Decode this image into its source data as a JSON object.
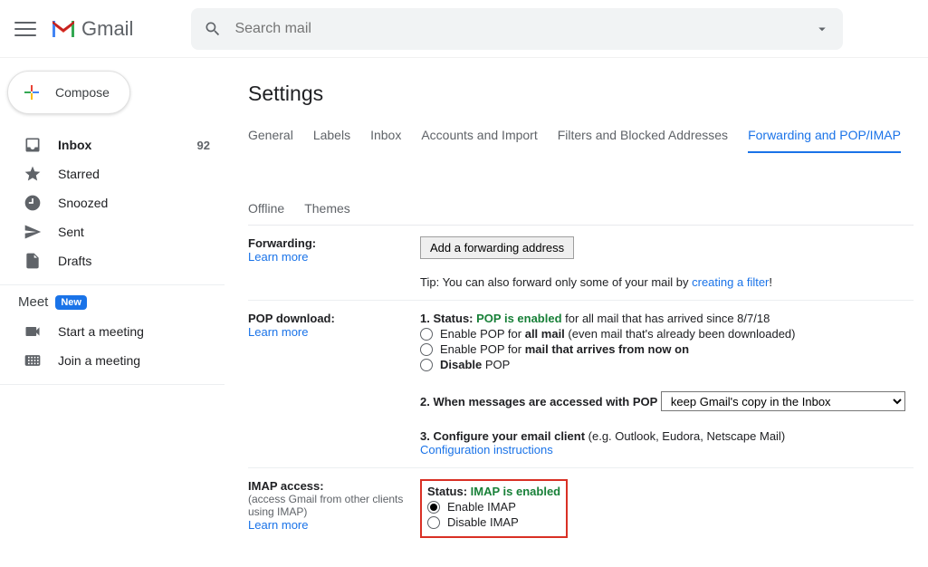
{
  "header": {
    "product": "Gmail",
    "search_placeholder": "Search mail"
  },
  "compose_label": "Compose",
  "sidebar": {
    "items": [
      {
        "label": "Inbox",
        "count": "92",
        "bold": true
      },
      {
        "label": "Starred"
      },
      {
        "label": "Snoozed"
      },
      {
        "label": "Sent"
      },
      {
        "label": "Drafts"
      }
    ]
  },
  "meet": {
    "title": "Meet",
    "badge": "New",
    "items": [
      {
        "label": "Start a meeting"
      },
      {
        "label": "Join a meeting"
      }
    ]
  },
  "settings_title": "Settings",
  "tabs": [
    "General",
    "Labels",
    "Inbox",
    "Accounts and Import",
    "Filters and Blocked Addresses",
    "Forwarding and POP/IMAP",
    "Offline",
    "Themes"
  ],
  "active_tab": "Forwarding and POP/IMAP",
  "forwarding": {
    "title": "Forwarding:",
    "learn": "Learn more",
    "button": "Add a forwarding address",
    "tip_prefix": "Tip: You can also forward only some of your mail by ",
    "tip_link": "creating a filter",
    "tip_excl": "!"
  },
  "pop": {
    "title": "POP download:",
    "learn": "Learn more",
    "line1_a": "1. Status: ",
    "line1_b": "POP is enabled",
    "line1_c": " for all mail that has arrived since 8/7/18",
    "r1a": "Enable POP for ",
    "r1b": "all mail",
    "r1c": " (even mail that's already been downloaded)",
    "r2a": "Enable POP for ",
    "r2b": "mail that arrives from now on",
    "r3a": "Disable",
    "r3b": " POP",
    "line2": "2. When messages are accessed with POP",
    "select": "keep Gmail's copy in the Inbox",
    "line3a": "3. Configure your email client",
    "line3b": " (e.g. Outlook, Eudora, Netscape Mail)",
    "conf": "Configuration instructions"
  },
  "imap": {
    "title": "IMAP access:",
    "sub": "(access Gmail from other clients using IMAP)",
    "learn": "Learn more",
    "status_a": "Status: ",
    "status_b": "IMAP is enabled",
    "r1": "Enable IMAP",
    "r2": "Disable IMAP"
  }
}
